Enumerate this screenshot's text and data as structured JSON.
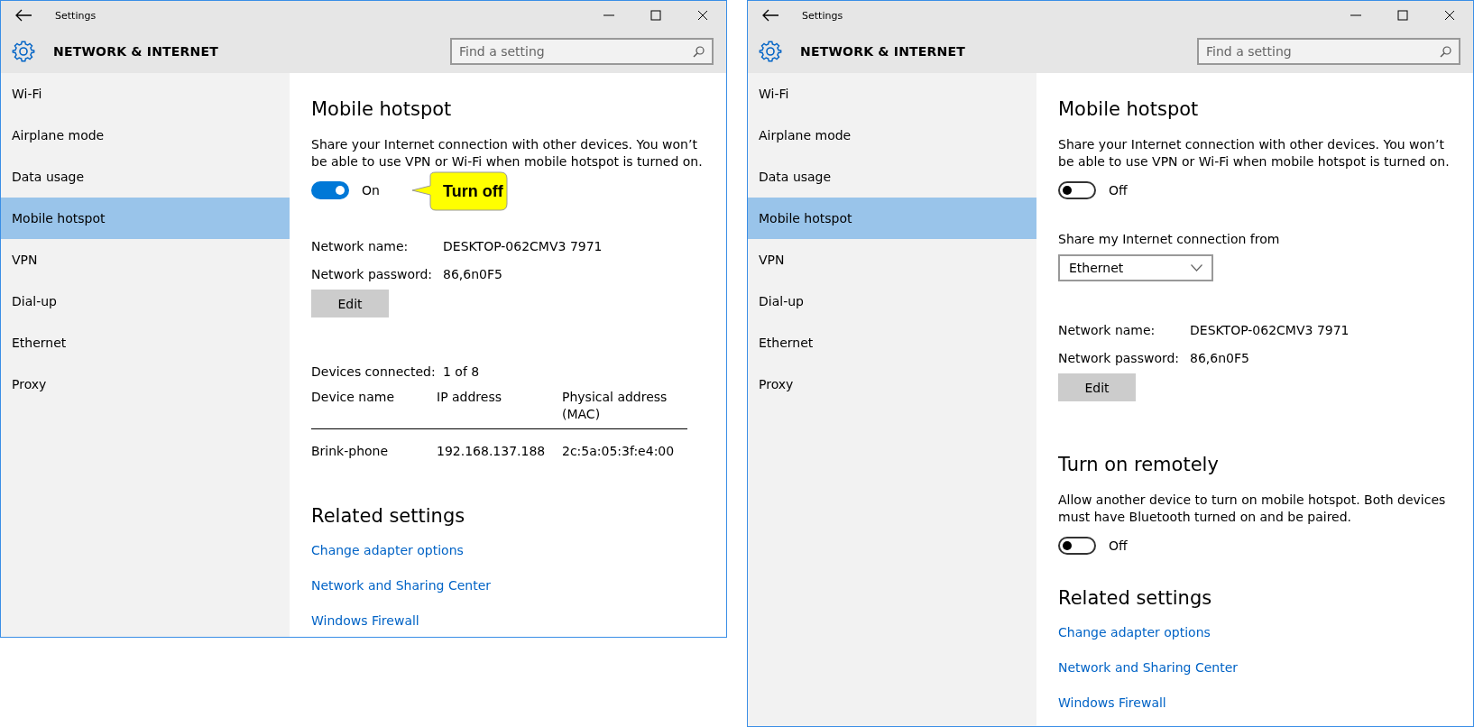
{
  "windows": [
    {
      "title": "Settings",
      "section_title": "NETWORK & INTERNET",
      "search": {
        "placeholder": "Find a setting"
      },
      "sidebar": [
        {
          "label": "Wi-Fi",
          "selected": false
        },
        {
          "label": "Airplane mode",
          "selected": false
        },
        {
          "label": "Data usage",
          "selected": false
        },
        {
          "label": "Mobile hotspot",
          "selected": true
        },
        {
          "label": "VPN",
          "selected": false
        },
        {
          "label": "Dial-up",
          "selected": false
        },
        {
          "label": "Ethernet",
          "selected": false
        },
        {
          "label": "Proxy",
          "selected": false
        }
      ],
      "content": [
        {
          "kind": "heading",
          "text": "Mobile hotspot"
        },
        {
          "kind": "paragraph",
          "text": "Share your Internet connection with other devices. You won’t be able to use VPN or Wi-Fi when mobile hotspot is turned on."
        },
        {
          "kind": "toggle",
          "on": true,
          "label": "On",
          "callout": "Turn off"
        },
        {
          "kind": "info",
          "rows": [
            {
              "label": "Network name:",
              "value": "DESKTOP-062CMV3 7971"
            },
            {
              "label": "Network password:",
              "value": "86,6n0F5"
            }
          ]
        },
        {
          "kind": "button",
          "label": "Edit"
        },
        {
          "kind": "devices",
          "summary_label": "Devices connected:",
          "summary_value": "1 of 8",
          "columns": [
            "Device name",
            "IP address",
            "Physical address (MAC)"
          ],
          "rows": [
            [
              "Brink-phone",
              "192.168.137.188",
              "2c:5a:05:3f:e4:00"
            ]
          ]
        },
        {
          "kind": "heading",
          "text": "Related settings"
        },
        {
          "kind": "link",
          "text": "Change adapter options"
        },
        {
          "kind": "link",
          "text": "Network and Sharing Center"
        },
        {
          "kind": "link",
          "text": "Windows Firewall"
        }
      ]
    },
    {
      "title": "Settings",
      "section_title": "NETWORK & INTERNET",
      "search": {
        "placeholder": "Find a setting"
      },
      "sidebar": [
        {
          "label": "Wi-Fi",
          "selected": false
        },
        {
          "label": "Airplane mode",
          "selected": false
        },
        {
          "label": "Data usage",
          "selected": false
        },
        {
          "label": "Mobile hotspot",
          "selected": true
        },
        {
          "label": "VPN",
          "selected": false
        },
        {
          "label": "Dial-up",
          "selected": false
        },
        {
          "label": "Ethernet",
          "selected": false
        },
        {
          "label": "Proxy",
          "selected": false
        }
      ],
      "content": [
        {
          "kind": "heading",
          "text": "Mobile hotspot"
        },
        {
          "kind": "paragraph",
          "text": "Share your Internet connection with other devices. You won’t be able to use VPN or Wi-Fi when mobile hotspot is turned on."
        },
        {
          "kind": "toggle",
          "on": false,
          "label": "Off"
        },
        {
          "kind": "dropdown",
          "label": "Share my Internet connection from",
          "value": "Ethernet"
        },
        {
          "kind": "info",
          "rows": [
            {
              "label": "Network name:",
              "value": "DESKTOP-062CMV3 7971"
            },
            {
              "label": "Network password:",
              "value": "86,6n0F5"
            }
          ]
        },
        {
          "kind": "button",
          "label": "Edit"
        },
        {
          "kind": "heading",
          "text": "Turn on remotely"
        },
        {
          "kind": "paragraph",
          "text": "Allow another device to turn on mobile hotspot. Both devices must have Bluetooth turned on and be paired."
        },
        {
          "kind": "toggle",
          "on": false,
          "label": "Off"
        },
        {
          "kind": "heading",
          "text": "Related settings"
        },
        {
          "kind": "link",
          "text": "Change adapter options"
        },
        {
          "kind": "link",
          "text": "Network and Sharing Center"
        },
        {
          "kind": "link",
          "text": "Windows Firewall"
        }
      ]
    }
  ]
}
